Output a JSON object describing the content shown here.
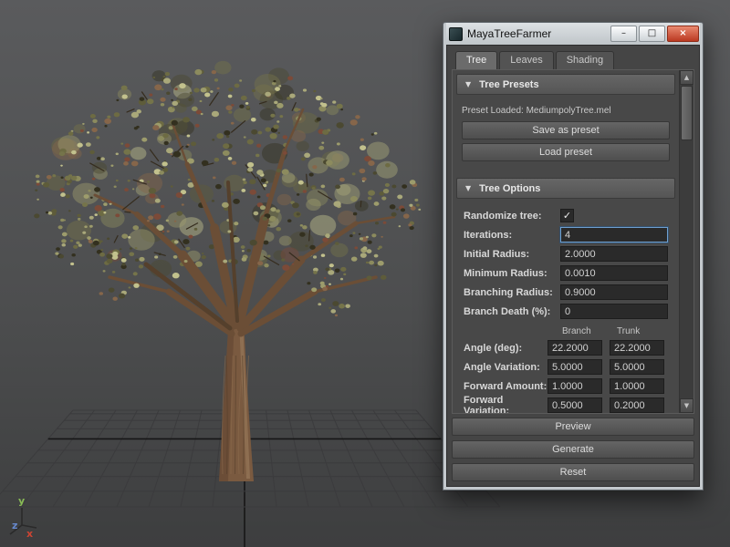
{
  "window": {
    "title": "MayaTreeFarmer",
    "tabs": [
      {
        "label": "Tree"
      },
      {
        "label": "Leaves"
      },
      {
        "label": "Shading"
      }
    ],
    "presets": {
      "title": "Tree Presets",
      "loaded_text": "Preset Loaded: MediumpolyTree.mel",
      "save_button": "Save as preset",
      "load_button": "Load preset"
    },
    "options": {
      "title": "Tree Options",
      "fields": [
        {
          "label": "Randomize tree:",
          "checked": true
        },
        {
          "label": "Iterations:",
          "value": "4"
        },
        {
          "label": "Initial Radius:",
          "value": "2.0000"
        },
        {
          "label": "Minimum Radius:",
          "value": "0.0010"
        },
        {
          "label": "Branching Radius:",
          "value": "0.9000"
        },
        {
          "label": "Branch Death (%):",
          "value": "0"
        }
      ],
      "columns": {
        "branch": "Branch",
        "trunk": "Trunk"
      },
      "dual_fields": [
        {
          "label": "Angle (deg):",
          "branch": "22.2000",
          "trunk": "22.2000"
        },
        {
          "label": "Angle Variation:",
          "branch": "5.0000",
          "trunk": "5.0000"
        },
        {
          "label": "Forward Amount:",
          "branch": "1.0000",
          "trunk": "1.0000"
        },
        {
          "label": "Forward Variation:",
          "branch": "0.5000",
          "trunk": "0.2000"
        }
      ]
    },
    "footer_buttons": [
      {
        "label": "Preview"
      },
      {
        "label": "Generate"
      },
      {
        "label": "Reset"
      }
    ]
  },
  "viewport": {
    "axis": {
      "x": "x",
      "y": "y",
      "z": "z"
    }
  },
  "icons": {
    "collapse_triangle": "▼",
    "checkmark": "✓",
    "scroll_up": "▲",
    "scroll_down": "▼",
    "minimize": "–",
    "maximize": "□",
    "close": "×"
  },
  "colors": {
    "axis_x": "#cc4433",
    "axis_y": "#88bb55",
    "axis_z": "#6688cc",
    "focus_border": "#6fa0d0"
  }
}
